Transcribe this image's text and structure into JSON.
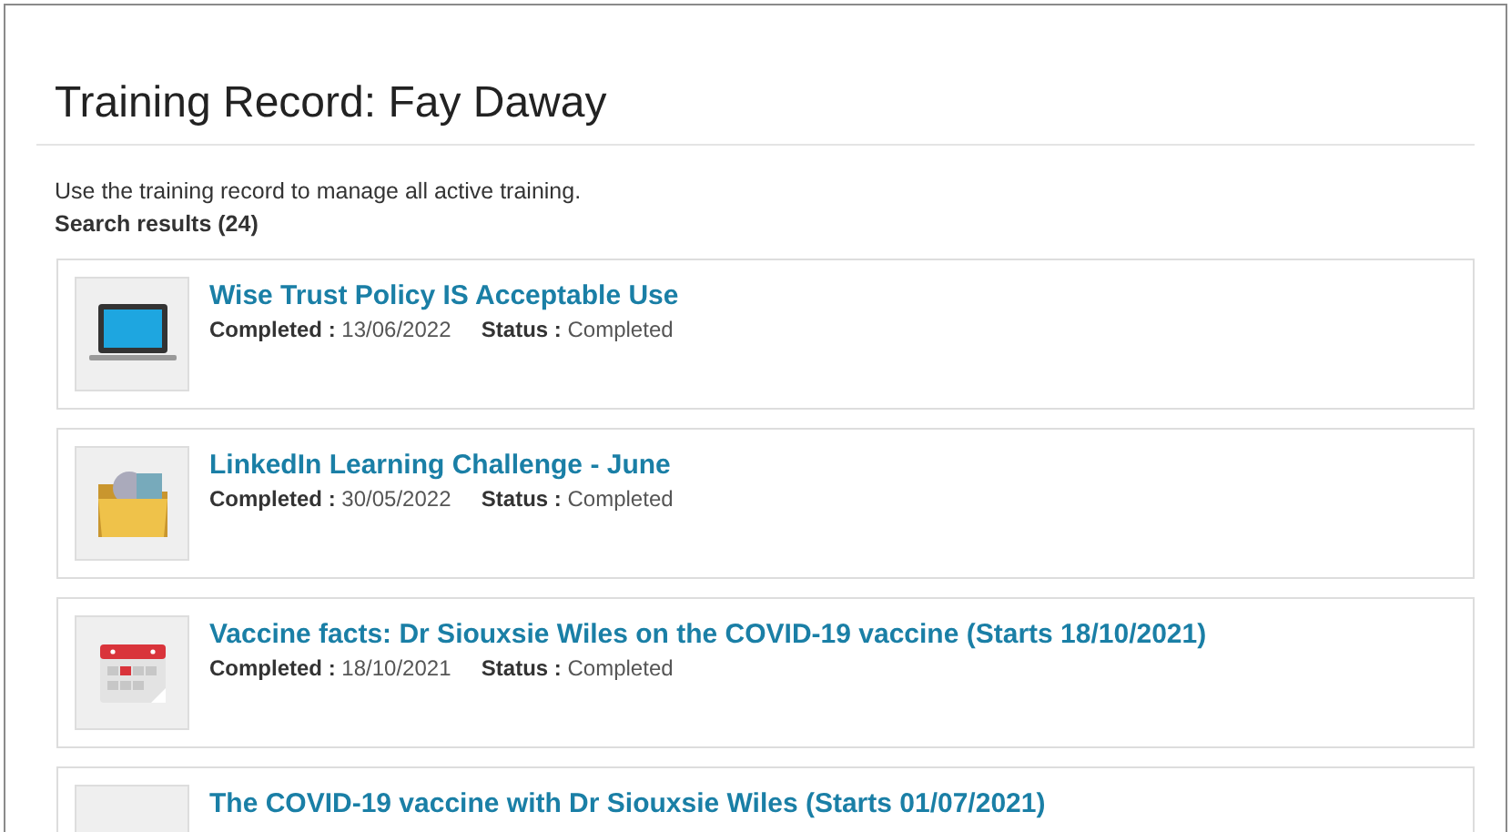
{
  "page": {
    "title": "Training Record: Fay Daway",
    "intro": "Use the training record to manage all active training.",
    "results_label": "Search results (24)"
  },
  "results": [
    {
      "kind": "laptop",
      "title": "Wise Trust Policy IS Acceptable Use",
      "completed_label": "Completed :",
      "completed": "13/06/2022",
      "status_label": "Status :",
      "status": "Completed"
    },
    {
      "kind": "folder",
      "title": "LinkedIn Learning Challenge - June",
      "completed_label": "Completed :",
      "completed": "30/05/2022",
      "status_label": "Status :",
      "status": "Completed"
    },
    {
      "kind": "calendar",
      "title": "Vaccine facts: Dr Siouxsie Wiles on the COVID-19 vaccine (Starts 18/10/2021)",
      "completed_label": "Completed :",
      "completed": "18/10/2021",
      "status_label": "Status :",
      "status": "Completed"
    },
    {
      "title": "The COVID-19 vaccine with Dr Siouxsie Wiles (Starts 01/07/2021)"
    }
  ]
}
